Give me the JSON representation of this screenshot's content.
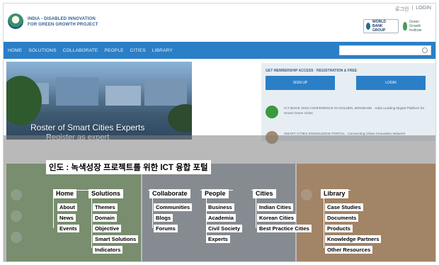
{
  "header": {
    "top_links": [
      "로그인",
      "|",
      "LOGIN"
    ],
    "brand_line1": "INDIA - DISABLED INNOVATION",
    "brand_line2": "FOR GREEN GROWTH PROJECT",
    "partner1": "WORLD BANK GROUP",
    "partner2": "Green Growth Institute"
  },
  "nav": {
    "items": [
      "HOME",
      "SOLUTIONS",
      "COLLABORATE",
      "PEOPLE",
      "CITIES",
      "LIBRARY"
    ]
  },
  "hero": {
    "title": "Roster of Smart Cities Experts",
    "subtitle": "Register as expert"
  },
  "panel": {
    "heading": "GET MEMBERSHIP ACCESS · REGISTRATION & FREE",
    "btn1": "SIGN UP",
    "btn2": "LOGIN",
    "news1": "ICT BOOK 2018 CONFERENCE IN GOLDEN, BRISBANE · India Leading Digital Platform for Smart Green Cities",
    "news2": "SMART CITIES KNOWLEDGE PORTAL · Connecting Urban Innovation Network"
  },
  "overlay": {
    "title": "인도 : 녹색성장 프로젝트를 위한 ICT 융합 포털",
    "menus": [
      {
        "head": "Home",
        "items": [
          "About",
          "News",
          "Events"
        ]
      },
      {
        "head": "Solutions",
        "items": [
          "Themes",
          "Domain",
          "Objective",
          "Smart Solutions",
          "Indicators"
        ]
      },
      {
        "head": "Collaborate",
        "items": [
          "Communities",
          "Blogs",
          "Forums"
        ]
      },
      {
        "head": "People",
        "items": [
          "Business",
          "Academia",
          "Civil Society",
          "Experts"
        ]
      },
      {
        "head": "Cities",
        "items": [
          "Indian Cities",
          "Korean Cities",
          "Best Practice Cities"
        ]
      },
      {
        "head": "Library",
        "items": [
          "Case Studies",
          "Documents",
          "Products",
          "Knowledge Partners",
          "Other Resources"
        ]
      }
    ]
  },
  "colors": {
    "nav_blue": "#2b7fc6",
    "overlay_gray": "rgba(128,128,128,.55)",
    "block_green": "#76a35c",
    "block_orange": "#d18b4a"
  }
}
